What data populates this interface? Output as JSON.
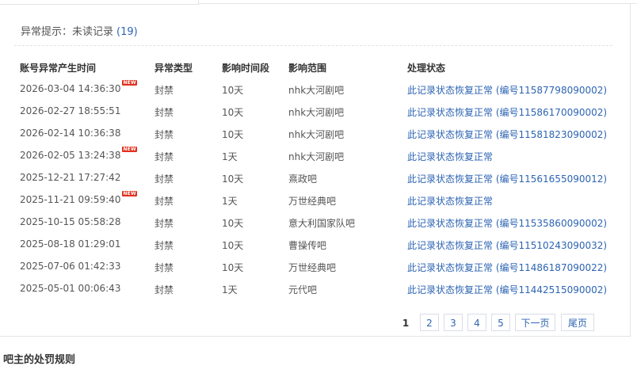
{
  "notice": {
    "label": "异常提示：未读记录",
    "count": "(19)"
  },
  "columns": [
    "账号异常产生时间",
    "异常类型",
    "影响时间段",
    "影响范围",
    "处理状态"
  ],
  "rows": [
    {
      "time": "2026-03-04 14:36:30",
      "new": true,
      "type": "封禁",
      "duration": "10天",
      "scope": "nhk大河剧吧",
      "status": "此记录状态恢复正常 (编号11587798090002)"
    },
    {
      "time": "2026-02-27 18:55:51",
      "new": false,
      "type": "封禁",
      "duration": "10天",
      "scope": "nhk大河剧吧",
      "status": "此记录状态恢复正常 (编号11586170090002)"
    },
    {
      "time": "2026-02-14 10:36:38",
      "new": false,
      "type": "封禁",
      "duration": "10天",
      "scope": "nhk大河剧吧",
      "status": "此记录状态恢复正常 (编号11581823090002)"
    },
    {
      "time": "2026-02-05 13:24:38",
      "new": true,
      "type": "封禁",
      "duration": "1天",
      "scope": "nhk大河剧吧",
      "status": "此记录状态恢复正常"
    },
    {
      "time": "2025-12-21 17:27:42",
      "new": false,
      "type": "封禁",
      "duration": "10天",
      "scope": "熹政吧",
      "status": "此记录状态恢复正常 (编号11561655090012)"
    },
    {
      "time": "2025-11-21 09:59:40",
      "new": true,
      "type": "封禁",
      "duration": "1天",
      "scope": "万世经典吧",
      "status": "此记录状态恢复正常"
    },
    {
      "time": "2025-10-15 05:58:28",
      "new": false,
      "type": "封禁",
      "duration": "10天",
      "scope": "意大利国家队吧",
      "status": "此记录状态恢复正常 (编号11535860090002)"
    },
    {
      "time": "2025-08-18 01:29:01",
      "new": false,
      "type": "封禁",
      "duration": "10天",
      "scope": "曹操传吧",
      "status": "此记录状态恢复正常 (编号11510243090032)"
    },
    {
      "time": "2025-07-06 01:42:33",
      "new": false,
      "type": "封禁",
      "duration": "10天",
      "scope": "万世经典吧",
      "status": "此记录状态恢复正常 (编号11486187090022)"
    },
    {
      "time": "2025-05-01 00:06:43",
      "new": false,
      "type": "封禁",
      "duration": "1天",
      "scope": "元代吧",
      "status": "此记录状态恢复正常 (编号11442515090002)"
    }
  ],
  "new_badge": "NEW",
  "pagination": {
    "pages": [
      "1",
      "2",
      "3",
      "4",
      "5"
    ],
    "current": "1",
    "next": "下一页",
    "last": "尾页"
  },
  "footer_title": "吧主的处罚规则"
}
